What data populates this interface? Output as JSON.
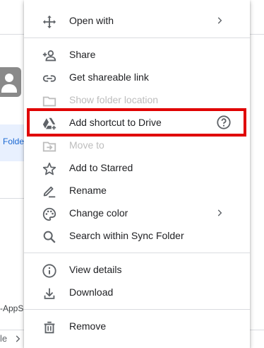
{
  "background": {
    "selected_item_label": "Folde",
    "file_label_fragment": "-AppS",
    "breadcrumb_fragment": "le"
  },
  "menu": {
    "items": [
      {
        "label": "Open with",
        "icon": "open-with-icon",
        "submenu": true
      },
      {
        "label": "Share",
        "icon": "person-add-icon"
      },
      {
        "label": "Get shareable link",
        "icon": "link-icon"
      },
      {
        "label": "Show folder location",
        "icon": "folder-icon",
        "disabled": true
      },
      {
        "label": "Add shortcut to Drive",
        "icon": "drive-shortcut-icon",
        "help": true,
        "highlighted": true
      },
      {
        "label": "Move to",
        "icon": "move-to-icon",
        "disabled": true
      },
      {
        "label": "Add to Starred",
        "icon": "star-icon"
      },
      {
        "label": "Rename",
        "icon": "rename-icon"
      },
      {
        "label": "Change color",
        "icon": "palette-icon",
        "submenu": true
      },
      {
        "label": "Search within Sync Folder",
        "icon": "search-icon"
      },
      {
        "label": "View details",
        "icon": "info-icon"
      },
      {
        "label": "Download",
        "icon": "download-icon"
      },
      {
        "label": "Remove",
        "icon": "trash-icon"
      }
    ]
  },
  "colors": {
    "highlight_border": "#e00000",
    "icon": "#5f6368",
    "disabled": "#bdbdbd",
    "text": "#202124"
  }
}
